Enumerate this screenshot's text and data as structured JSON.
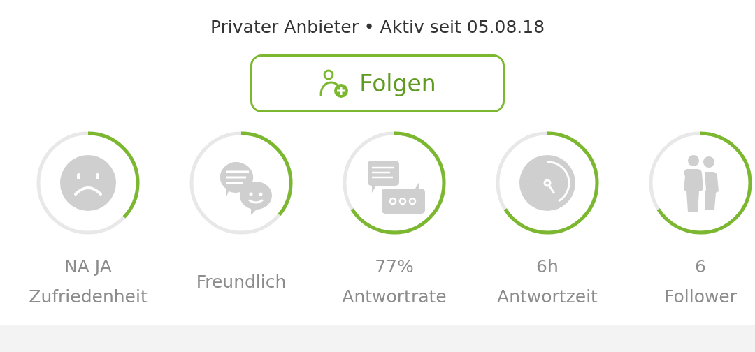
{
  "header": {
    "text": "Privater Anbieter • Aktiv seit 05.08.18"
  },
  "follow_button": {
    "label": "Folgen"
  },
  "stats": [
    {
      "kind": "sad-face",
      "level": 0.37,
      "lines": [
        "NA JA",
        "Zufriedenheit"
      ]
    },
    {
      "kind": "chat",
      "level": 0.36,
      "lines": [
        "Freundlich"
      ]
    },
    {
      "kind": "messages",
      "level": 0.66,
      "lines": [
        "77%",
        "Antwortrate"
      ]
    },
    {
      "kind": "clock",
      "level": 0.66,
      "lines": [
        "6h",
        "Antwortzeit"
      ]
    },
    {
      "kind": "people",
      "level": 0.66,
      "lines": [
        "6",
        "Follower"
      ]
    }
  ]
}
